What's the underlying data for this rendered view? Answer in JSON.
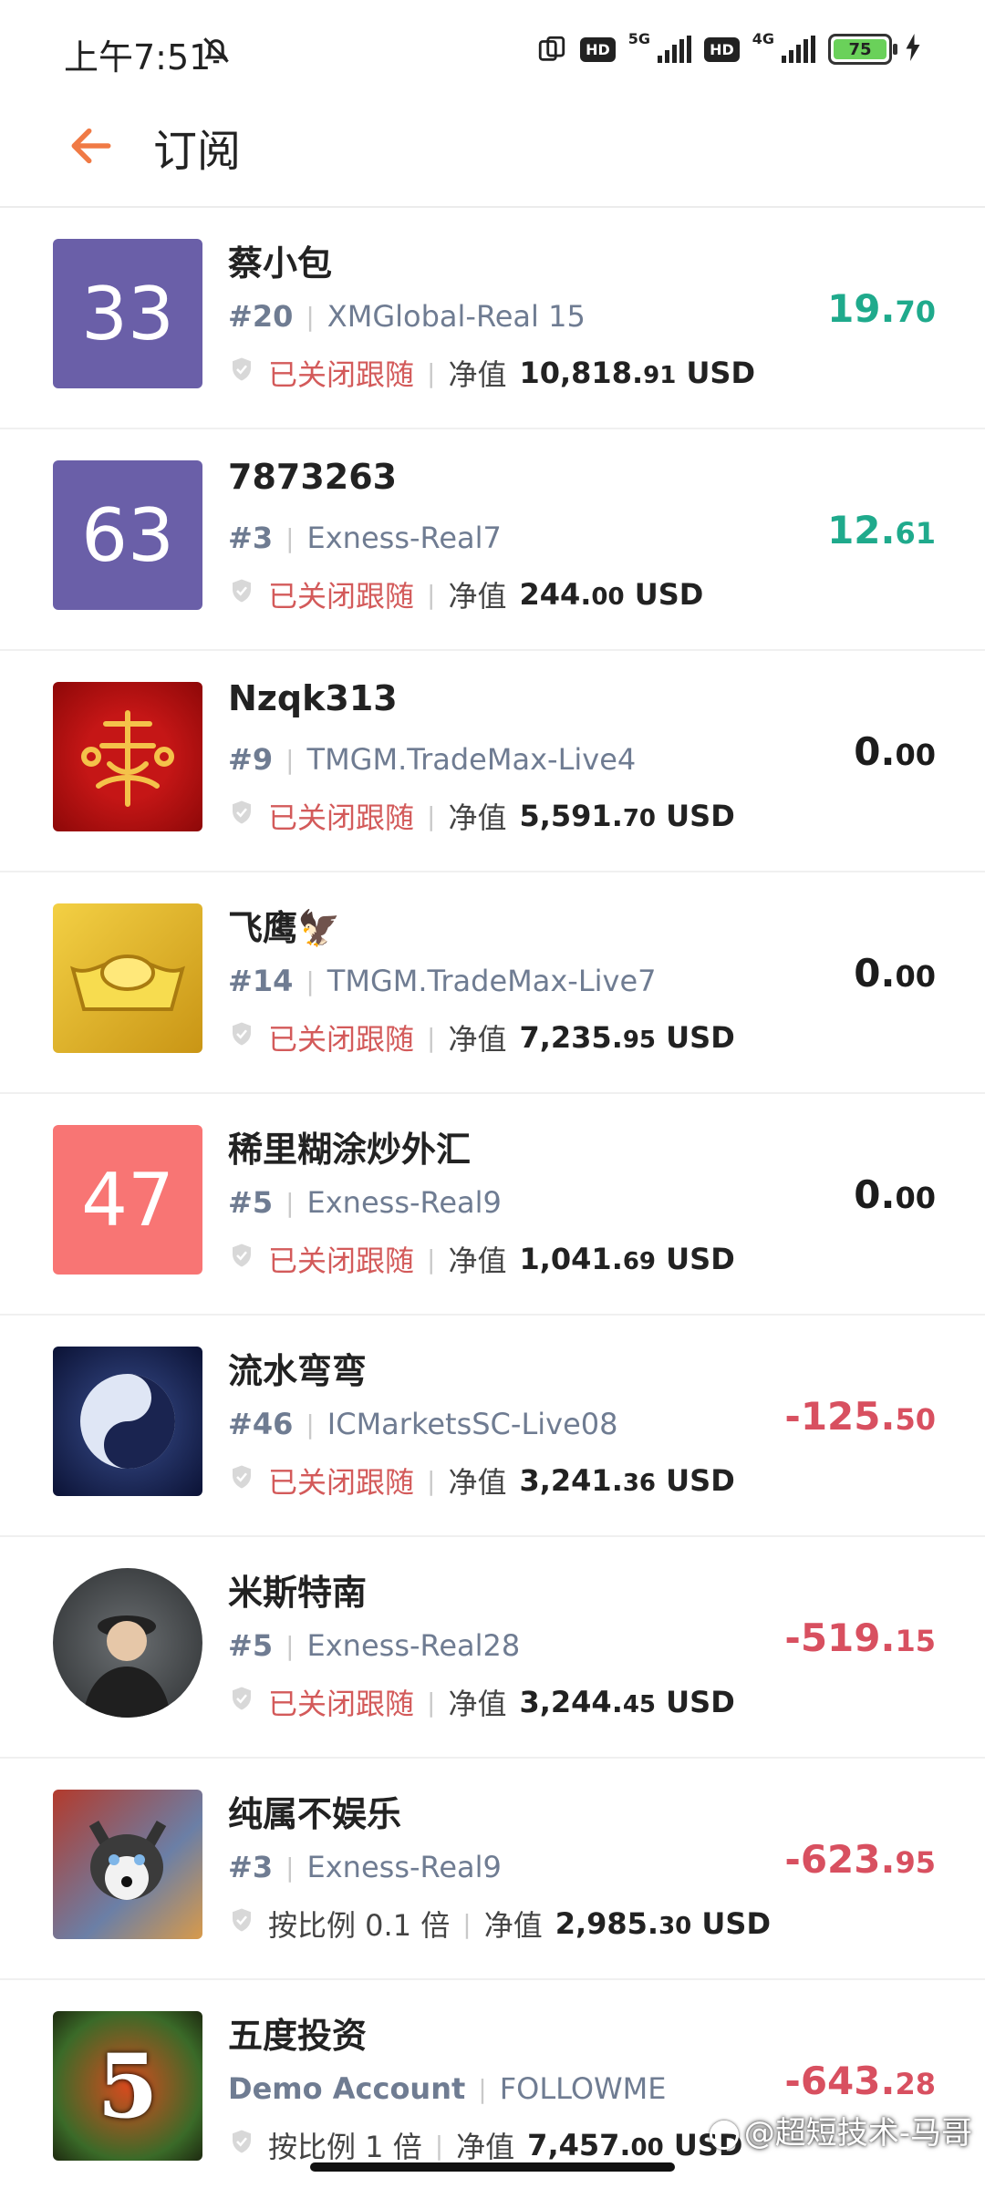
{
  "status_bar": {
    "time": "上午7:51",
    "net1": "5G",
    "net2": "4G",
    "hd": "HD",
    "battery": "75"
  },
  "header": {
    "title": "订阅"
  },
  "subscriptions": [
    {
      "avatar_type": "number",
      "avatar_text": "33",
      "avatar_color": "#6a5fa8",
      "name": "蔡小包",
      "rank": "#20",
      "server": "XMGlobal-Real 15",
      "status": "已关闭跟随",
      "status_kind": "closed",
      "nv_label": "净值",
      "nv_int": "10,818.",
      "nv_dec": "91",
      "nv_unit": "USD",
      "profit_int": "19.",
      "profit_dec": "70",
      "profit_kind": "pos"
    },
    {
      "avatar_type": "number",
      "avatar_text": "63",
      "avatar_color": "#6a5fa8",
      "name": "7873263",
      "rank": "#3",
      "server": "Exness-Real7",
      "status": "已关闭跟随",
      "status_kind": "closed",
      "nv_label": "净值",
      "nv_int": "244.",
      "nv_dec": "00",
      "nv_unit": "USD",
      "profit_int": "12.",
      "profit_dec": "61",
      "profit_kind": "pos"
    },
    {
      "avatar_type": "image",
      "avatar_icon": "red-calligraphy-avatar",
      "name": "Nzqk313",
      "rank": "#9",
      "server": "TMGM.TradeMax-Live4",
      "status": "已关闭跟随",
      "status_kind": "closed",
      "nv_label": "净值",
      "nv_int": "5,591.",
      "nv_dec": "70",
      "nv_unit": "USD",
      "profit_int": "0.",
      "profit_dec": "00",
      "profit_kind": "zero"
    },
    {
      "avatar_type": "image",
      "avatar_icon": "gold-ingot-avatar",
      "name": "飞鹰🦅",
      "rank": "#14",
      "server": "TMGM.TradeMax-Live7",
      "status": "已关闭跟随",
      "status_kind": "closed",
      "nv_label": "净值",
      "nv_int": "7,235.",
      "nv_dec": "95",
      "nv_unit": "USD",
      "profit_int": "0.",
      "profit_dec": "00",
      "profit_kind": "zero"
    },
    {
      "avatar_type": "number",
      "avatar_text": "47",
      "avatar_color": "#f87574",
      "name": "稀里糊涂炒外汇",
      "rank": "#5",
      "server": "Exness-Real9",
      "status": "已关闭跟随",
      "status_kind": "closed",
      "nv_label": "净值",
      "nv_int": "1,041.",
      "nv_dec": "69",
      "nv_unit": "USD",
      "profit_int": "0.",
      "profit_dec": "00",
      "profit_kind": "zero"
    },
    {
      "avatar_type": "image",
      "avatar_icon": "yin-yang-avatar",
      "name": "流水弯弯",
      "rank": "#46",
      "server": "ICMarketsSC-Live08",
      "status": "已关闭跟随",
      "status_kind": "closed",
      "nv_label": "净值",
      "nv_int": "3,241.",
      "nv_dec": "36",
      "nv_unit": "USD",
      "profit_int": "-125.",
      "profit_dec": "50",
      "profit_kind": "neg"
    },
    {
      "avatar_type": "image",
      "avatar_icon": "person-photo-avatar",
      "name": "米斯特南",
      "rank": "#5",
      "server": "Exness-Real28",
      "status": "已关闭跟随",
      "status_kind": "closed",
      "nv_label": "净值",
      "nv_int": "3,244.",
      "nv_dec": "45",
      "nv_unit": "USD",
      "profit_int": "-519.",
      "profit_dec": "15",
      "profit_kind": "neg"
    },
    {
      "avatar_type": "image",
      "avatar_icon": "husky-dog-avatar",
      "name": "纯属不娱乐",
      "rank": "#3",
      "server": "Exness-Real9",
      "status": "按比例 0.1 倍",
      "status_kind": "ratio",
      "nv_label": "净值",
      "nv_int": "2,985.",
      "nv_dec": "30",
      "nv_unit": "USD",
      "profit_int": "-623.",
      "profit_dec": "95",
      "profit_kind": "neg"
    },
    {
      "avatar_type": "image",
      "avatar_icon": "dragon-five-avatar",
      "name": "五度投资",
      "rank": "Demo Account",
      "server": "FOLLOWME",
      "status": "按比例 1 倍",
      "status_kind": "ratio",
      "nv_label": "净值",
      "nv_int": "7,457.",
      "nv_dec": "00",
      "nv_unit": "USD",
      "profit_int": "-643.",
      "profit_dec": "28",
      "profit_kind": "neg"
    }
  ],
  "watermark": "@超短技术-马哥"
}
